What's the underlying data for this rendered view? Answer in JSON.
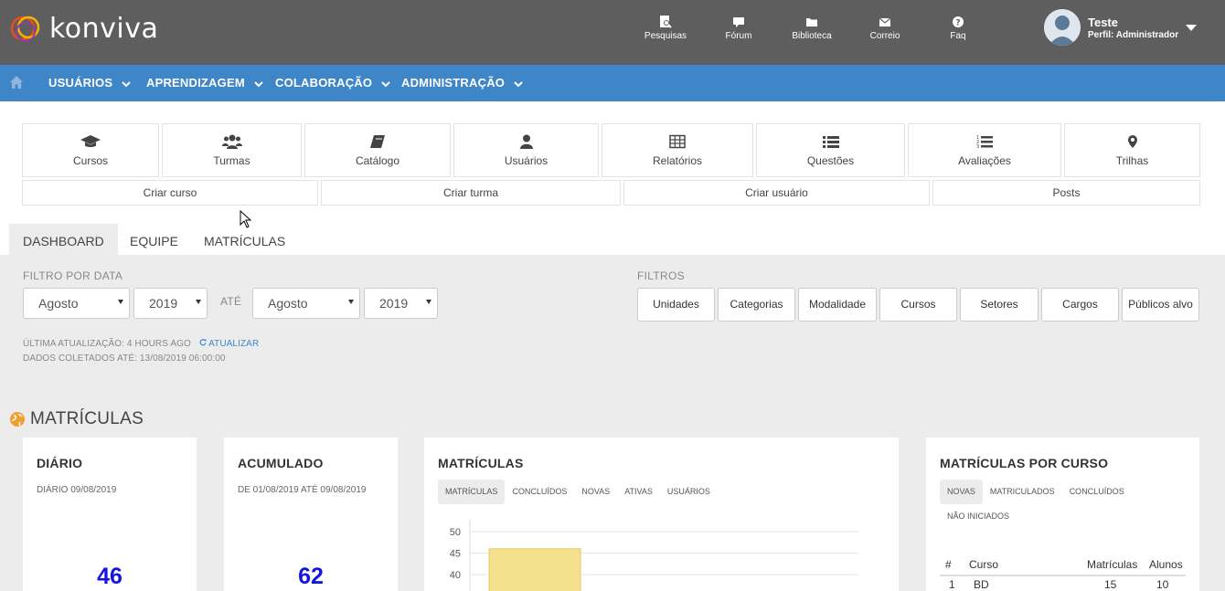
{
  "header": {
    "logo_text": "konviva",
    "nav": [
      {
        "label": "Pesquisas",
        "icon": "search-doc-icon"
      },
      {
        "label": "Fórum",
        "icon": "chat-icon"
      },
      {
        "label": "Biblioteca",
        "icon": "folder-icon"
      },
      {
        "label": "Correio",
        "icon": "mail-icon"
      },
      {
        "label": "Faq",
        "icon": "question-icon"
      }
    ],
    "user": {
      "name": "Teste",
      "role": "Perfil: Administrador"
    }
  },
  "menu": {
    "items": [
      "USUÁRIOS",
      "APRENDIZAGEM",
      "COLABORAÇÃO",
      "ADMINISTRAÇÃO"
    ]
  },
  "shortcuts": [
    {
      "label": "Cursos",
      "icon": "graduation-cap-icon"
    },
    {
      "label": "Turmas",
      "icon": "users-icon"
    },
    {
      "label": "Catálogo",
      "icon": "book-icon"
    },
    {
      "label": "Usuários",
      "icon": "user-icon"
    },
    {
      "label": "Relatórios",
      "icon": "table-icon"
    },
    {
      "label": "Questões",
      "icon": "list-icon"
    },
    {
      "label": "Avaliações",
      "icon": "ordered-list-icon"
    },
    {
      "label": "Trilhas",
      "icon": "map-pin-icon"
    }
  ],
  "quick_actions": [
    "Criar curso",
    "Criar turma",
    "Criar usuário",
    "Posts"
  ],
  "tabs": [
    "DASHBOARD",
    "EQUIPE",
    "MATRÍCULAS"
  ],
  "date_filter": {
    "label": "FILTRO POR DATA",
    "from_month": "Agosto",
    "from_year": "2019",
    "to_label": "ATÉ",
    "to_month": "Agosto",
    "to_year": "2019"
  },
  "filters": {
    "label": "FILTROS",
    "buttons": [
      "Unidades",
      "Categorias",
      "Modalidade",
      "Cursos",
      "Setores",
      "Cargos",
      "Públicos alvo"
    ]
  },
  "status": {
    "last_update": "ÚLTIMA ATUALIZAÇÃO: 4 HOURS AGO",
    "refresh": "ATUALIZAR",
    "collected": "DADOS COLETADOS ATÉ: 13/08/2019 06:00:00"
  },
  "section_title": "MATRÍCULAS",
  "cards": {
    "daily": {
      "title": "DIÁRIO",
      "subtitle": "DIÁRIO 09/08/2019",
      "value": "46"
    },
    "cumulative": {
      "title": "ACUMULADO",
      "subtitle": "DE 01/08/2019 ATÉ 09/08/2019",
      "value": "62"
    },
    "enrollments": {
      "title": "MATRÍCULAS",
      "pills": [
        "MATRÍCULAS",
        "CONCLUÍDOS",
        "NOVAS",
        "ATIVAS",
        "USUÁRIOS"
      ]
    },
    "by_course": {
      "title": "MATRÍCULAS POR CURSO",
      "pills": [
        "NOVAS",
        "MATRICULADOS",
        "CONCLUÍDOS",
        "NÃO INICIADOS"
      ],
      "columns": [
        "#",
        "Curso",
        "Matrículas",
        "Alunos"
      ],
      "rows": [
        [
          "1",
          "BD",
          "15",
          "10"
        ]
      ]
    }
  },
  "chart_data": {
    "type": "bar",
    "y_ticks": [
      "50",
      "45",
      "40"
    ],
    "ylim": [
      40,
      50
    ],
    "categories": [
      ""
    ],
    "values": [
      46
    ],
    "color": "#f5e08e"
  }
}
